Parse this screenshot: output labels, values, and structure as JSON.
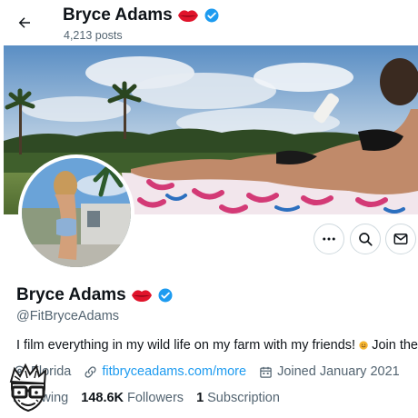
{
  "header": {
    "name": "Bryce Adams",
    "posts_label": "4,213 posts",
    "back_icon": "arrow-left-icon"
  },
  "profile": {
    "display_name": "Bryce Adams",
    "handle": "@FitBryceAdams",
    "bio": "I film everything in my wild life on my farm with my friends!",
    "bio_tail": "Join the",
    "emoji_name": "lips-emoji",
    "verified_icon": "verified-badge-icon"
  },
  "actions": {
    "more_icon": "more-icon",
    "search_icon": "search-icon",
    "message_icon": "mail-icon"
  },
  "meta": {
    "location": "Florida",
    "website": "fitbryceadams.com/more",
    "joined": "Joined January 2021"
  },
  "counts": {
    "following_label": "Following",
    "followers_value": "148.6K",
    "followers_label": "Followers",
    "subscriptions_value": "1",
    "subscriptions_label": "Subscription"
  },
  "colors": {
    "accent": "#1d9bf0",
    "secondary_text": "#536471",
    "primary_text": "#0f1419",
    "lips": "#e0142b"
  }
}
